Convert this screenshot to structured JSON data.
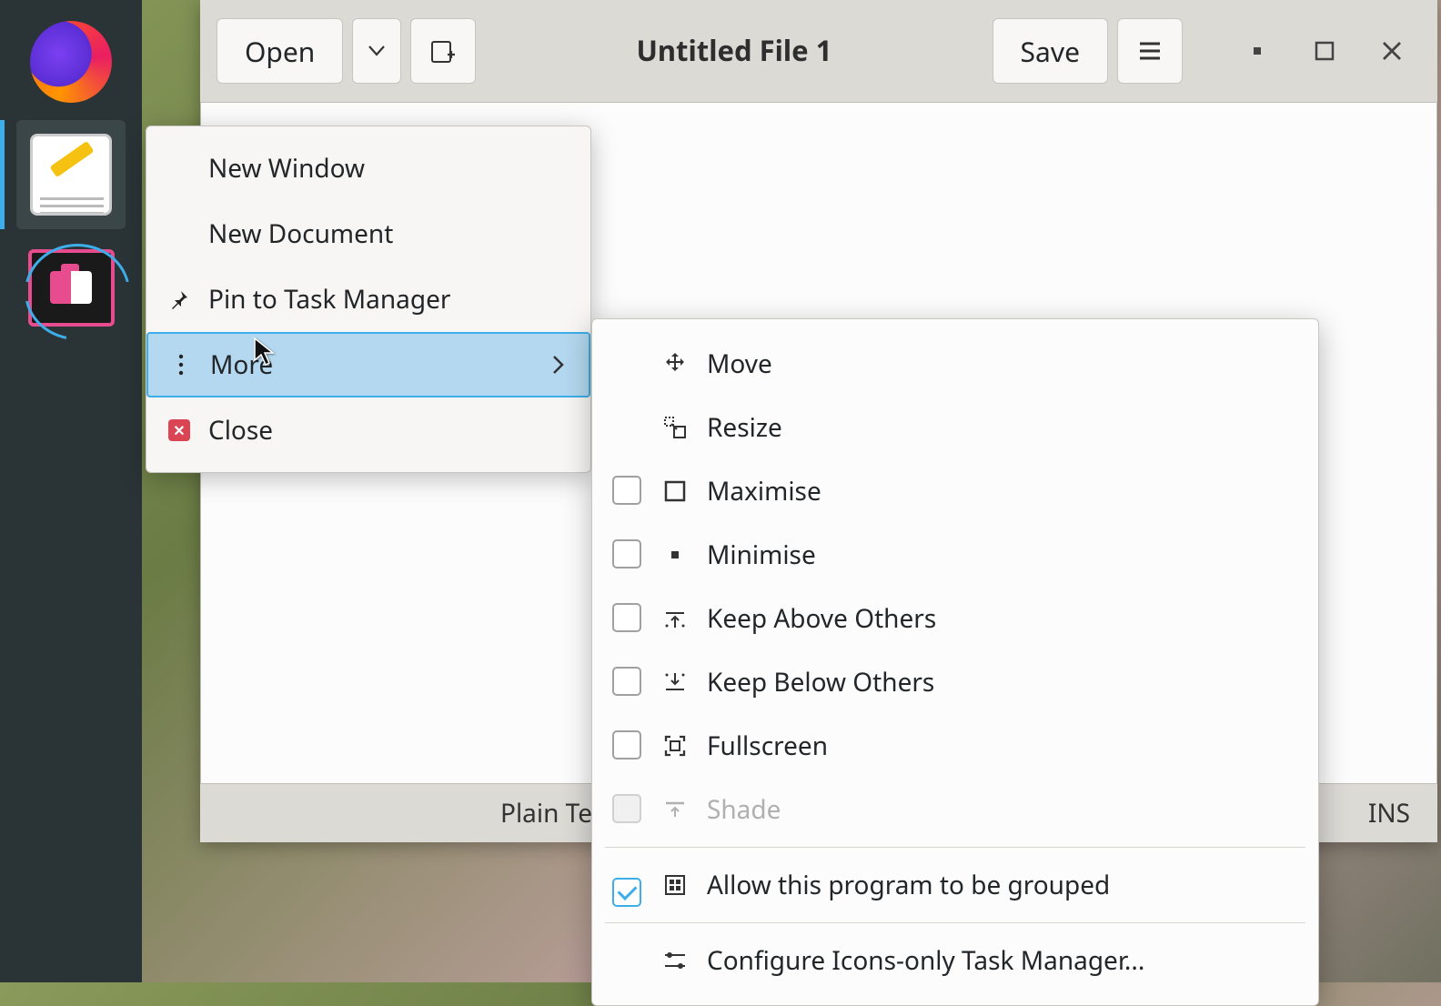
{
  "taskbar": {
    "items": [
      {
        "name": "firefox"
      },
      {
        "name": "text-editor",
        "active": true
      },
      {
        "name": "spectacle"
      }
    ]
  },
  "window": {
    "open": "Open",
    "title": "Untitled File 1",
    "save": "Save"
  },
  "status": {
    "mode": "Plain Tex",
    "insert": "INS"
  },
  "contextMenu": {
    "newWindow": "New Window",
    "newDocument": "New Document",
    "pin": "Pin to Task Manager",
    "more": "More",
    "close": "Close"
  },
  "submenu": {
    "move": "Move",
    "resize": "Resize",
    "maximise": "Maximise",
    "minimise": "Minimise",
    "keepAbove": "Keep Above Others",
    "keepBelow": "Keep Below Others",
    "fullscreen": "Fullscreen",
    "shade": "Shade",
    "allowGroup": "Allow this program to be grouped",
    "configure": "Configure Icons-only Task Manager..."
  }
}
